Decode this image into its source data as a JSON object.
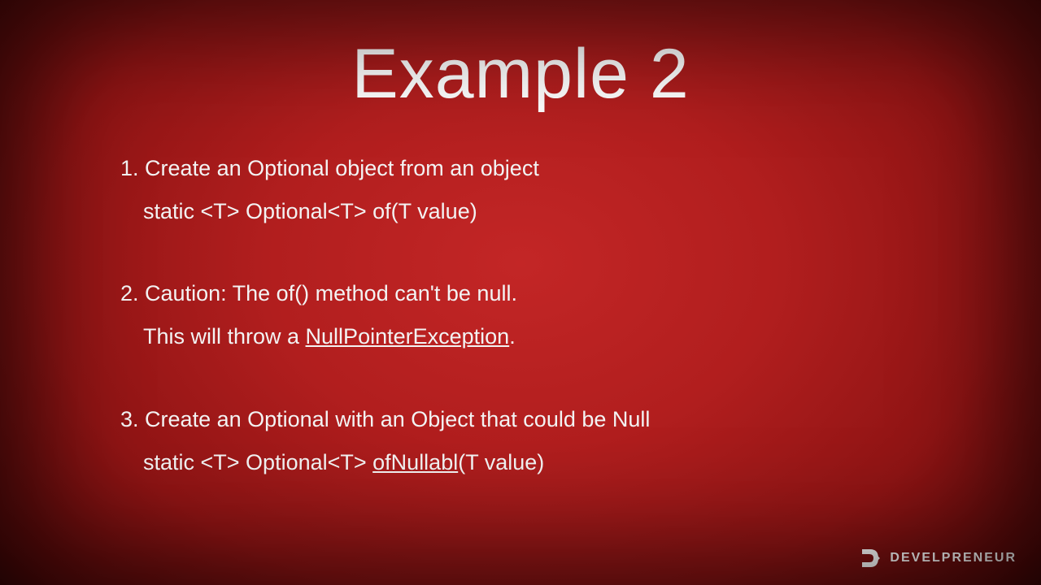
{
  "title": "Example 2",
  "items": [
    {
      "num": "1.",
      "line1": "Create an Optional object from an object",
      "code": "static <T> Optional<T> of(T value)"
    },
    {
      "num": "2.",
      "line1": "Caution: The of() method can't be null.",
      "line2_pre": "This will throw a ",
      "line2_under": "NullPointerException",
      "line2_post": "."
    },
    {
      "num": "3.",
      "line1": "Create an Optional with an Object that could be Null",
      "code_pre": "static <T> Optional<T> ",
      "code_under": "ofNullabl",
      "code_post": "(T value)"
    }
  ],
  "logo": {
    "text": "DEVELPRENEUR"
  }
}
